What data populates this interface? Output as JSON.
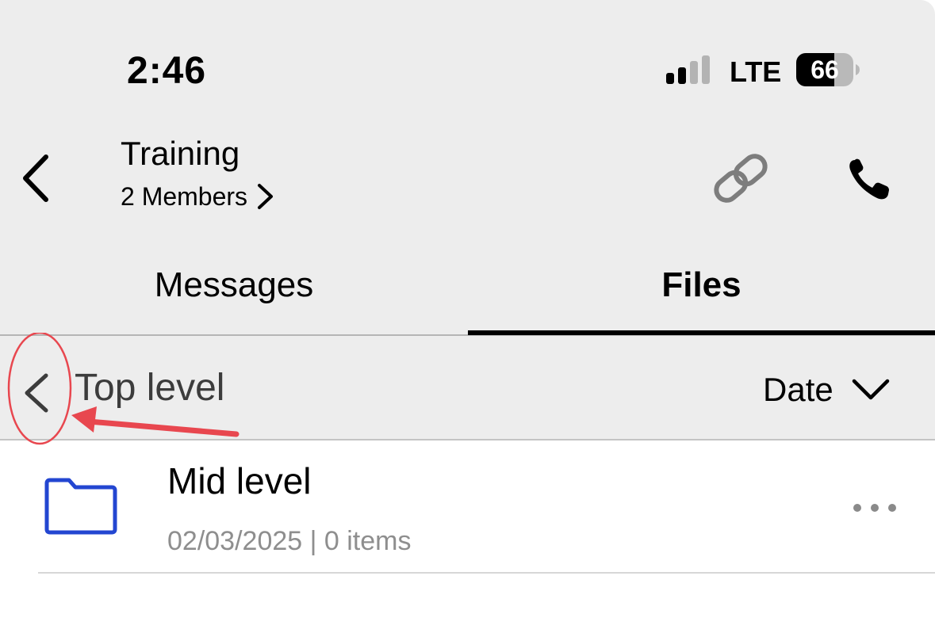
{
  "status_bar": {
    "time": "2:46",
    "network": "LTE",
    "battery_level": "66",
    "battery_fraction": 0.66,
    "signal_bars_filled": 2,
    "signal_bars_total": 4
  },
  "header": {
    "title": "Training",
    "members": "2 Members",
    "icons": [
      "back-chevron-icon",
      "link-icon",
      "phone-icon"
    ]
  },
  "tabs": [
    {
      "label": "Messages",
      "active": false
    },
    {
      "label": "Files",
      "active": true
    }
  ],
  "navigation": {
    "current_folder": "Top level",
    "sort_label": "Date",
    "icons": [
      "back-chevron-icon",
      "chevron-down-icon"
    ]
  },
  "annotation": {
    "color": "#e8474f"
  },
  "files": [
    {
      "name": "Mid level",
      "meta": "02/03/2025 | 0 items",
      "icon": "folder-icon",
      "icon_color": "#2346d1"
    }
  ]
}
